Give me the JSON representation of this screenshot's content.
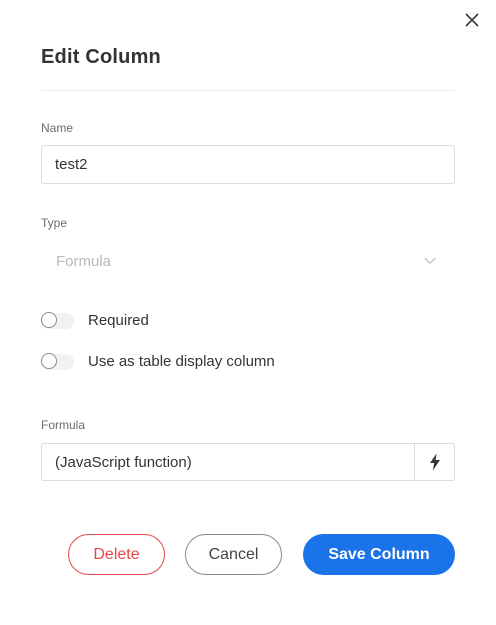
{
  "dialog": {
    "title": "Edit Column",
    "close_icon": "close-icon"
  },
  "name_field": {
    "label": "Name",
    "value": "test2"
  },
  "type_field": {
    "label": "Type",
    "selected": "Formula",
    "icon": "chevron-down-icon",
    "disabled": true
  },
  "toggles": {
    "required": {
      "label": "Required",
      "checked": false
    },
    "display_column": {
      "label": "Use as table display column",
      "checked": false
    }
  },
  "formula_field": {
    "label": "Formula",
    "value": "(JavaScript function)",
    "button_icon": "lightning-bolt-icon"
  },
  "actions": {
    "delete_label": "Delete",
    "cancel_label": "Cancel",
    "save_label": "Save Column"
  },
  "colors": {
    "primary": "#1a73e8",
    "danger": "#e64949",
    "neutral_border": "#8a8a8a"
  }
}
